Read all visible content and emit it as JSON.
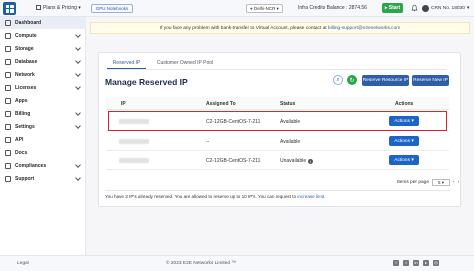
{
  "header": {
    "plans_label": "Plans & Pricing",
    "gpu_label": "GPU Notebooks",
    "region": "Delhi-NCR",
    "credits": "Infra Credits Balance : 2874.56",
    "start_label": "Start",
    "crn": "CRN No. 18030"
  },
  "sidebar": {
    "items": [
      {
        "label": "Dashboard"
      },
      {
        "label": "Compute"
      },
      {
        "label": "Storage"
      },
      {
        "label": "Database"
      },
      {
        "label": "Network"
      },
      {
        "label": "Licenses"
      },
      {
        "label": "Apps"
      },
      {
        "label": "Billing"
      },
      {
        "label": "Settings"
      },
      {
        "label": "API"
      },
      {
        "label": "Docs"
      },
      {
        "label": "Compliances"
      },
      {
        "label": "Support"
      }
    ]
  },
  "banner": {
    "text": "If you face any problem with bank-transfer to Virtual Account, please contact at",
    "email": "billing-support@e2enetworks.com"
  },
  "tabs": [
    "Reserved IP",
    "Customer Owned IP Pool"
  ],
  "main": {
    "title": "Manage Reserved IP",
    "reserve_resource_label": "Reserve Resource IP",
    "reserve_new_label": "Reserve New IP"
  },
  "table": {
    "columns": [
      "IP",
      "Assigned To",
      "Status",
      "Actions"
    ],
    "rows": [
      {
        "assigned": "C2-12GB-CentOS-7-211",
        "status": "Available",
        "action": "Actions"
      },
      {
        "assigned": "--",
        "status": "Available",
        "action": "Actions"
      },
      {
        "assigned": "C2-12GB-CentOS-7-211",
        "status": "Unavailable",
        "action": "Actions"
      }
    ]
  },
  "pager": {
    "label": "Items per page",
    "value": "5"
  },
  "note": {
    "text": "You have 3 IP's already reserved. You are allowed to reserve up to 10 IP's. You can request to",
    "link": "increase limit."
  },
  "footer": {
    "legal": "Legal",
    "copyright": "© 2023 E2E Networks Limited ™"
  },
  "colors": {
    "brand": "#2f5ea8",
    "highlight": "#d5262b",
    "success": "#2ea44f"
  }
}
